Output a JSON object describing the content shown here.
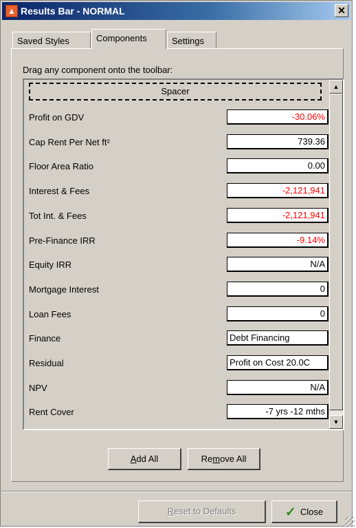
{
  "window": {
    "title": "Results Bar - NORMAL",
    "close_glyph": "✕"
  },
  "tabs": [
    {
      "label": "Saved Styles"
    },
    {
      "label": "Components"
    },
    {
      "label": "Settings"
    }
  ],
  "active_tab": "Components",
  "hint": "Drag any component onto the toolbar:",
  "components": {
    "spacer_label": "Spacer",
    "rows": [
      {
        "label": "Profit on GDV",
        "value": "-30.06%",
        "negative": true
      },
      {
        "label": "Cap Rent Per Net ft²",
        "value": "739.36",
        "negative": false
      },
      {
        "label": "Floor Area Ratio",
        "value": "0.00",
        "negative": false
      },
      {
        "label": "Interest & Fees",
        "value": "-2,121,941",
        "negative": true
      },
      {
        "label": "Tot Int. & Fees",
        "value": "-2,121,941",
        "negative": true
      },
      {
        "label": "Pre-Finance IRR",
        "value": "-9.14%",
        "negative": true
      },
      {
        "label": "Equity IRR",
        "value": "N/A",
        "negative": false
      },
      {
        "label": "Mortgage Interest",
        "value": "0",
        "negative": false
      },
      {
        "label": "Loan Fees",
        "value": "0",
        "negative": false
      },
      {
        "label": "Finance",
        "value": "Debt Financing",
        "negative": false,
        "text": true
      },
      {
        "label": "Residual",
        "value": "Profit on Cost 20.0C",
        "negative": false,
        "text": true
      },
      {
        "label": "NPV",
        "value": "N/A",
        "negative": false
      },
      {
        "label": "Rent Cover",
        "value": "-7 yrs -12 mths",
        "negative": false
      }
    ]
  },
  "buttons": {
    "add_all": {
      "prefix": "",
      "accel": "A",
      "rest": "dd All"
    },
    "remove_all": {
      "prefix": "Re",
      "accel": "m",
      "rest": "ove All"
    },
    "reset": {
      "prefix": "",
      "accel": "R",
      "rest": "eset to Defaults"
    },
    "close": {
      "label": "Close"
    }
  },
  "colors": {
    "negative": "#ff0000",
    "title_bar": "#0a246a",
    "check": "#2a8a1a"
  }
}
